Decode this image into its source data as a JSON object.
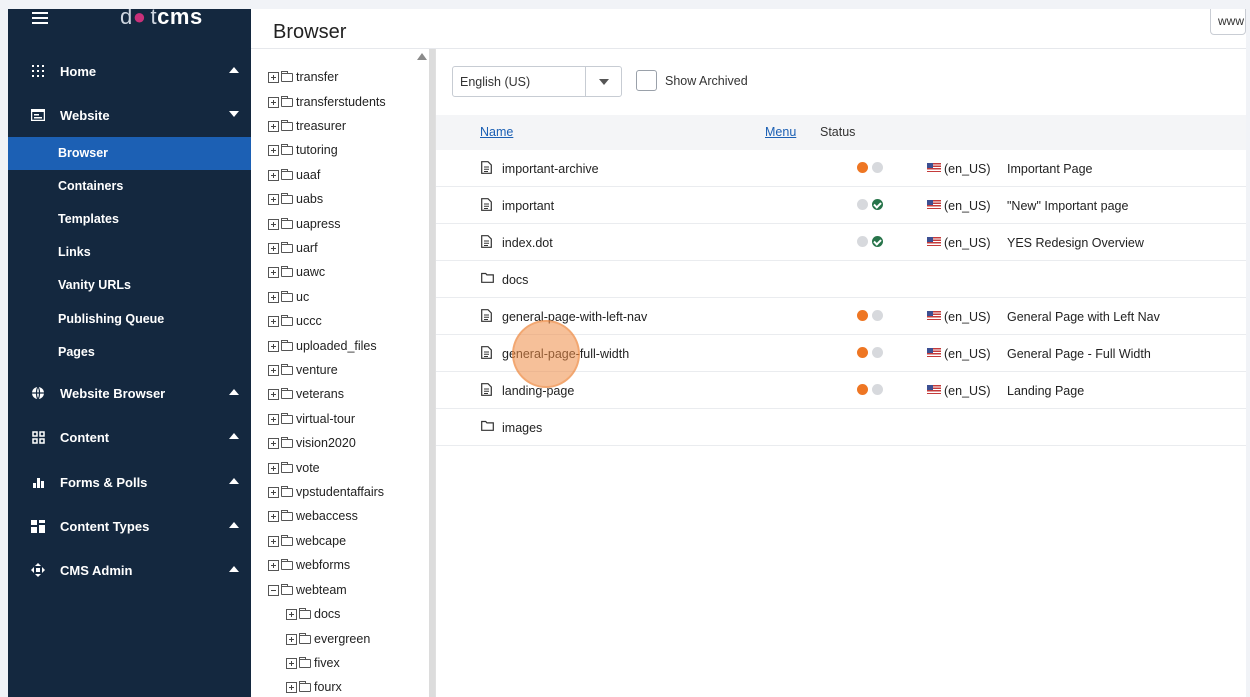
{
  "sidebar": {
    "logo": {
      "pre": "d",
      "dot": "●",
      "post": "t",
      "bold": "cms"
    },
    "groups": [
      {
        "label": "Home",
        "icon": "dashboard-icon",
        "expanded": false
      },
      {
        "label": "Website",
        "icon": "window-icon",
        "expanded": true
      },
      {
        "label": "Website Browser",
        "icon": "globe-icon",
        "expanded": false
      },
      {
        "label": "Content",
        "icon": "grid-icon",
        "expanded": false
      },
      {
        "label": "Forms & Polls",
        "icon": "bar-chart-icon",
        "expanded": false
      },
      {
        "label": "Content Types",
        "icon": "blocks-icon",
        "expanded": false
      },
      {
        "label": "CMS Admin",
        "icon": "arrows-icon",
        "expanded": false
      }
    ],
    "subitems": [
      "Browser",
      "Containers",
      "Templates",
      "Links",
      "Vanity URLs",
      "Publishing Queue",
      "Pages"
    ],
    "active_subitem": "Browser"
  },
  "header": {
    "title": "Browser",
    "site": "www"
  },
  "tree": {
    "items": [
      {
        "label": "transfer",
        "expanded": false,
        "indent": 0
      },
      {
        "label": "transferstudents",
        "expanded": false,
        "indent": 0
      },
      {
        "label": "treasurer",
        "expanded": false,
        "indent": 0
      },
      {
        "label": "tutoring",
        "expanded": false,
        "indent": 0
      },
      {
        "label": "uaaf",
        "expanded": false,
        "indent": 0
      },
      {
        "label": "uabs",
        "expanded": false,
        "indent": 0
      },
      {
        "label": "uapress",
        "expanded": false,
        "indent": 0
      },
      {
        "label": "uarf",
        "expanded": false,
        "indent": 0
      },
      {
        "label": "uawc",
        "expanded": false,
        "indent": 0
      },
      {
        "label": "uc",
        "expanded": false,
        "indent": 0
      },
      {
        "label": "uccc",
        "expanded": false,
        "indent": 0
      },
      {
        "label": "uploaded_files",
        "expanded": false,
        "indent": 0
      },
      {
        "label": "venture",
        "expanded": false,
        "indent": 0
      },
      {
        "label": "veterans",
        "expanded": false,
        "indent": 0
      },
      {
        "label": "virtual-tour",
        "expanded": false,
        "indent": 0
      },
      {
        "label": "vision2020",
        "expanded": false,
        "indent": 0
      },
      {
        "label": "vote",
        "expanded": false,
        "indent": 0
      },
      {
        "label": "vpstudentaffairs",
        "expanded": false,
        "indent": 0
      },
      {
        "label": "webaccess",
        "expanded": false,
        "indent": 0
      },
      {
        "label": "webcape",
        "expanded": false,
        "indent": 0
      },
      {
        "label": "webforms",
        "expanded": false,
        "indent": 0
      },
      {
        "label": "webteam",
        "expanded": true,
        "indent": 0
      },
      {
        "label": "docs",
        "expanded": false,
        "indent": 1
      },
      {
        "label": "evergreen",
        "expanded": false,
        "indent": 1
      },
      {
        "label": "fivex",
        "expanded": false,
        "indent": 1
      },
      {
        "label": "fourx",
        "expanded": false,
        "indent": 1
      }
    ]
  },
  "main": {
    "language": "English (US)",
    "show_archived_label": "Show Archived",
    "columns": {
      "name": "Name",
      "menu": "Menu",
      "status": "Status"
    },
    "rows": [
      {
        "type": "page",
        "name": "important-archive",
        "status": [
          "orange",
          "grey"
        ],
        "lang": "(en_US)",
        "title": "Important Page"
      },
      {
        "type": "page",
        "name": "important",
        "status": [
          "grey",
          "green"
        ],
        "lang": "(en_US)",
        "title": "\"New\" Important page"
      },
      {
        "type": "page",
        "name": "index.dot",
        "status": [
          "grey",
          "green"
        ],
        "lang": "(en_US)",
        "title": "YES Redesign Overview"
      },
      {
        "type": "folder",
        "name": "docs",
        "status": [],
        "lang": "",
        "title": ""
      },
      {
        "type": "page",
        "name": "general-page-with-left-nav",
        "status": [
          "orange",
          "grey"
        ],
        "lang": "(en_US)",
        "title": "General Page with Left Nav"
      },
      {
        "type": "page",
        "name": "general-page-full-width",
        "status": [
          "orange",
          "grey"
        ],
        "lang": "(en_US)",
        "title": "General Page - Full Width"
      },
      {
        "type": "page",
        "name": "landing-page",
        "status": [
          "orange",
          "grey"
        ],
        "lang": "(en_US)",
        "title": "Landing Page"
      },
      {
        "type": "folder",
        "name": "images",
        "status": [],
        "lang": "",
        "title": ""
      }
    ]
  },
  "colors": {
    "sidebar_bg": "#14283f",
    "active": "#1c60b4",
    "orange": "#ee7623",
    "green": "#27744a"
  }
}
